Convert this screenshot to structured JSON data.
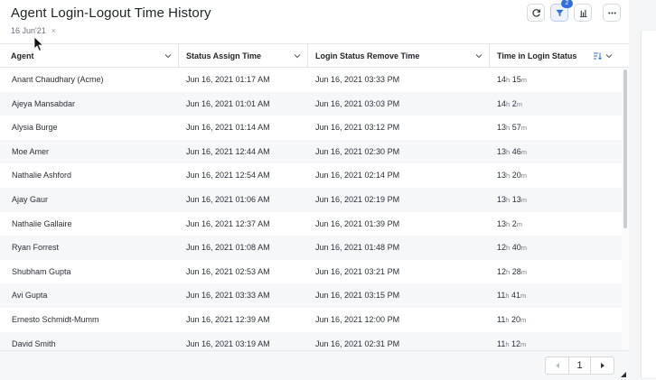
{
  "title": "Agent Login-Logout Time History",
  "filter": {
    "date": "16 Jun'21",
    "clear": "×"
  },
  "toolbar": {
    "refresh_icon": "refresh-icon",
    "filter_icon": "filter-icon",
    "filter_badge": "2",
    "chart_icon": "bar-chart-icon",
    "more_icon": "more-icon"
  },
  "table": {
    "columns": [
      "Agent",
      "Status Assign Time",
      "Login Status Remove Time",
      "Time in Login Status"
    ],
    "rows": [
      {
        "agent": "Anant Chaudhary (Acme)",
        "assign": "Jun 16, 2021 01:17 AM",
        "remove": "Jun 16, 2021 03:33 PM",
        "h": "14",
        "m": "15"
      },
      {
        "agent": "Ajeya Mansabdar",
        "assign": "Jun 16, 2021 01:01 AM",
        "remove": "Jun 16, 2021 03:03 PM",
        "h": "14",
        "m": "2"
      },
      {
        "agent": "Alysia Burge",
        "assign": "Jun 16, 2021 01:14 AM",
        "remove": "Jun 16, 2021 03:12 PM",
        "h": "13",
        "m": "57"
      },
      {
        "agent": "Moe Amer",
        "assign": "Jun 16, 2021 12:44 AM",
        "remove": "Jun 16, 2021 02:30 PM",
        "h": "13",
        "m": "46"
      },
      {
        "agent": "Nathalie Ashford",
        "assign": "Jun 16, 2021 12:54 AM",
        "remove": "Jun 16, 2021 02:14 PM",
        "h": "13",
        "m": "20"
      },
      {
        "agent": "Ajay Gaur",
        "assign": "Jun 16, 2021 01:06 AM",
        "remove": "Jun 16, 2021 02:19 PM",
        "h": "13",
        "m": "13"
      },
      {
        "agent": "Nathalie Gallaire",
        "assign": "Jun 16, 2021 12:37 AM",
        "remove": "Jun 16, 2021 01:39 PM",
        "h": "13",
        "m": "2"
      },
      {
        "agent": "Ryan Forrest",
        "assign": "Jun 16, 2021 01:08 AM",
        "remove": "Jun 16, 2021 01:48 PM",
        "h": "12",
        "m": "40"
      },
      {
        "agent": "Shubham Gupta",
        "assign": "Jun 16, 2021 02:53 AM",
        "remove": "Jun 16, 2021 03:21 PM",
        "h": "12",
        "m": "28"
      },
      {
        "agent": "Avi Gupta",
        "assign": "Jun 16, 2021 03:33 AM",
        "remove": "Jun 16, 2021 03:15 PM",
        "h": "11",
        "m": "41"
      },
      {
        "agent": "Ernesto Schmidt-Mumm",
        "assign": "Jun 16, 2021 12:39 AM",
        "remove": "Jun 16, 2021 12:00 PM",
        "h": "11",
        "m": "20"
      },
      {
        "agent": "David Smith",
        "assign": "Jun 16, 2021 03:19 AM",
        "remove": "Jun 16, 2021 02:31 PM",
        "h": "11",
        "m": "12"
      }
    ],
    "hour_unit": "h",
    "minute_unit": "m"
  },
  "pagination": {
    "page": "1"
  },
  "colors": {
    "accent": "#2f6fe4",
    "row_alt": "#f6f7f9",
    "border": "#e4e6ea"
  }
}
